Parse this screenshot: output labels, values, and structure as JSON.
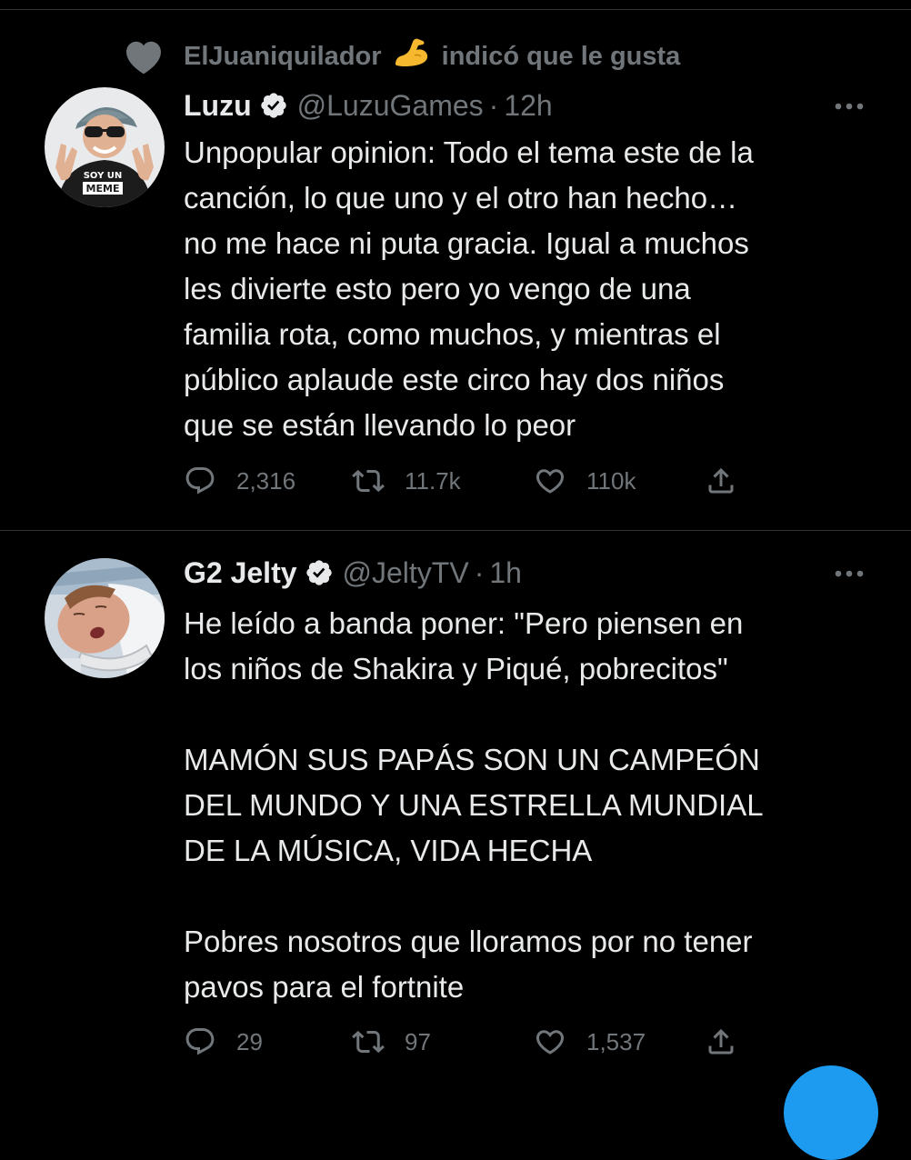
{
  "social_context": {
    "user": "ElJuaniquilador",
    "emoji": "💪",
    "text": "indicó que le gusta"
  },
  "tweets": [
    {
      "name": "Luzu",
      "handle": "@LuzuGames",
      "separator": "·",
      "time": "12h",
      "verified": true,
      "text": "Unpopular opinion: Todo el tema este de la\ncanción, lo que uno y el otro han hecho…\nno me hace ni puta gracia. Igual a muchos\nles divierte esto pero yo vengo de una\nfamilia rota, como muchos, y mientras el\npúblico aplaude este circo hay dos niños\nque se están llevando lo peor",
      "avatar_text": [
        "SOY UN",
        "MEME"
      ],
      "replies": "2,316",
      "retweets": "11.7k",
      "likes": "110k"
    },
    {
      "name": "G2 Jelty",
      "handle": "@JeltyTV",
      "separator": "·",
      "time": "1h",
      "verified": true,
      "text": "He leído a banda poner: \"Pero piensen en\nlos niños de Shakira y Piqué, pobrecitos\"\n\nMAMÓN SUS PAPÁS SON UN CAMPEÓN\nDEL MUNDO Y UNA ESTRELLA MUNDIAL\nDE LA MÚSICA, VIDA HECHA\n\nPobres nosotros que lloramos por no tener\npavos para el fortnite",
      "replies": "29",
      "retweets": "97",
      "likes": "1,537"
    }
  ],
  "colors": {
    "background": "#000000",
    "text": "#e7e9ea",
    "secondary": "#71767b",
    "divider": "#2f3336",
    "accent": "#1d9bf0"
  },
  "icons": {
    "social": "heart-solid-icon",
    "verified": "verified-badge-icon",
    "more": "more-options-icon",
    "reply": "reply-icon",
    "retweet": "retweet-icon",
    "like": "like-icon",
    "share": "share-icon"
  }
}
